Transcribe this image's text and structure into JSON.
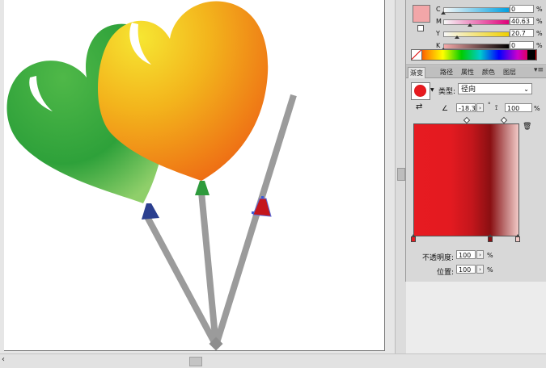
{
  "color_panel": {
    "swatch_color": "#f2a6a8",
    "sliders": [
      {
        "label": "C",
        "value": "0",
        "fraction": 0.0,
        "track_from": "#f7f7f7",
        "track_to": "#00a0e0"
      },
      {
        "label": "M",
        "value": "40.63",
        "fraction": 0.4063,
        "track_from": "#f7f7f7",
        "track_to": "#e0007a"
      },
      {
        "label": "Y",
        "value": "20.7",
        "fraction": 0.207,
        "track_from": "#f7f7f7",
        "track_to": "#f0d000"
      },
      {
        "label": "K",
        "value": "0",
        "fraction": 0.0,
        "track_from": "#f4a8a8",
        "track_to": "#000000"
      }
    ],
    "unit": "%"
  },
  "tabs": [
    {
      "label": "渐变",
      "active": true
    },
    {
      "label": "路径",
      "active": false
    },
    {
      "label": "属性",
      "active": false
    },
    {
      "label": "颜色",
      "active": false
    },
    {
      "label": "图层",
      "active": false
    }
  ],
  "gradient": {
    "type_label": "类型:",
    "type_value": "径向",
    "angle": "-18.3",
    "aspect": "100",
    "opacity_label": "不透明度:",
    "opacity_value": "100",
    "position_label": "位置:",
    "position_value": "100",
    "unit": "%",
    "stops": [
      {
        "position": 0,
        "color": "#e71b21"
      },
      {
        "position": 74,
        "color": "#8a0f12"
      },
      {
        "position": 100,
        "color": "#f2c9c6"
      }
    ]
  },
  "icons": {
    "panel_menu": "panel-menu-icon",
    "reverse": "reverse-gradient-icon",
    "angle": "angle-icon",
    "aspect": "aspect-ratio-icon",
    "trash": "trash-icon"
  }
}
